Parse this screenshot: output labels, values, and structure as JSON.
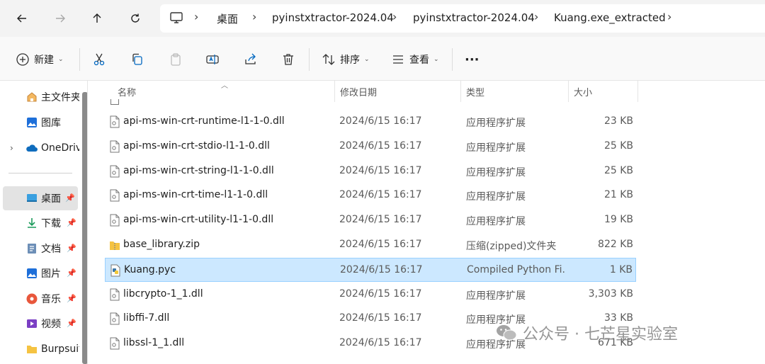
{
  "nav": {
    "back_icon": "arrow-left-icon",
    "forward_icon": "arrow-right-icon",
    "up_icon": "arrow-up-icon",
    "refresh_icon": "refresh-icon"
  },
  "breadcrumb": {
    "icon": "computer-icon",
    "items": [
      "桌面",
      "pyinstxtractor-2024.04",
      "pyinstxtractor-2024.04",
      "Kuang.exe_extracted"
    ]
  },
  "toolbar": {
    "new_label": "新建",
    "sort_label": "排序",
    "view_label": "查看",
    "more_label": "···"
  },
  "sidebar": {
    "items": [
      {
        "label": "主文件夹",
        "icon": "home-icon"
      },
      {
        "label": "图库",
        "icon": "gallery-icon"
      },
      {
        "label": "OneDrive",
        "icon": "cloud-icon"
      },
      {
        "label": "桌面",
        "icon": "desktop-icon"
      },
      {
        "label": "下载",
        "icon": "download-icon"
      },
      {
        "label": "文档",
        "icon": "document-icon"
      },
      {
        "label": "图片",
        "icon": "picture-icon"
      },
      {
        "label": "音乐",
        "icon": "music-icon"
      },
      {
        "label": "视频",
        "icon": "video-icon"
      },
      {
        "label": "Burpsuite",
        "icon": "folder-icon"
      }
    ]
  },
  "columns": {
    "name": "名称",
    "date": "修改日期",
    "type": "类型",
    "size": "大小"
  },
  "files": [
    {
      "name": "api-ms-win-crt-runtime-l1-1-0.dll",
      "date": "2024/6/15 16:17",
      "type": "应用程序扩展",
      "size": "23 KB",
      "icon": "dll-file-icon"
    },
    {
      "name": "api-ms-win-crt-stdio-l1-1-0.dll",
      "date": "2024/6/15 16:17",
      "type": "应用程序扩展",
      "size": "25 KB",
      "icon": "dll-file-icon"
    },
    {
      "name": "api-ms-win-crt-string-l1-1-0.dll",
      "date": "2024/6/15 16:17",
      "type": "应用程序扩展",
      "size": "25 KB",
      "icon": "dll-file-icon"
    },
    {
      "name": "api-ms-win-crt-time-l1-1-0.dll",
      "date": "2024/6/15 16:17",
      "type": "应用程序扩展",
      "size": "21 KB",
      "icon": "dll-file-icon"
    },
    {
      "name": "api-ms-win-crt-utility-l1-1-0.dll",
      "date": "2024/6/15 16:17",
      "type": "应用程序扩展",
      "size": "19 KB",
      "icon": "dll-file-icon"
    },
    {
      "name": "base_library.zip",
      "date": "2024/6/15 16:17",
      "type": "压缩(zipped)文件夹",
      "size": "822 KB",
      "icon": "zip-folder-icon"
    },
    {
      "name": "Kuang.pyc",
      "date": "2024/6/15 16:17",
      "type": "Compiled Python Fi...",
      "size": "1 KB",
      "icon": "python-file-icon",
      "selected": true
    },
    {
      "name": "libcrypto-1_1.dll",
      "date": "2024/6/15 16:17",
      "type": "应用程序扩展",
      "size": "3,303 KB",
      "icon": "dll-file-icon"
    },
    {
      "name": "libffi-7.dll",
      "date": "2024/6/15 16:17",
      "type": "应用程序扩展",
      "size": "33 KB",
      "icon": "dll-file-icon"
    },
    {
      "name": "libssl-1_1.dll",
      "date": "2024/6/15 16:17",
      "type": "应用程序扩展",
      "size": "671 KB",
      "icon": "dll-file-icon"
    }
  ],
  "watermark": {
    "text": "公众号 · 七芒星实验室",
    "icon": "wechat-icon"
  },
  "colors": {
    "selection_bg": "#cce8ff",
    "selection_border": "#99d1ff",
    "accent": "#0067c0"
  }
}
